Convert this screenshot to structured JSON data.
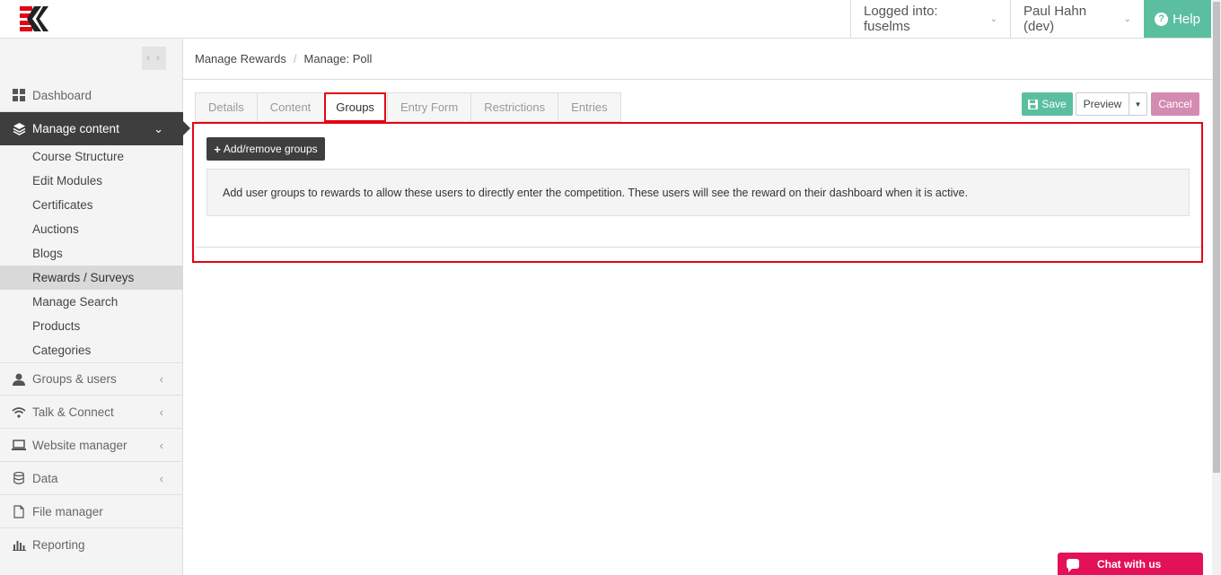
{
  "header": {
    "logged_into": "Logged into: fuselms",
    "user": "Paul Hahn (dev)",
    "help": "Help"
  },
  "sidebar": {
    "collapse_icon": "‹ ›",
    "items": [
      {
        "label": "Dashboard",
        "icon": "grid-icon"
      },
      {
        "label": "Manage content",
        "icon": "layers-icon",
        "active": true
      },
      {
        "label": "Groups & users",
        "icon": "user-icon"
      },
      {
        "label": "Talk & Connect",
        "icon": "wifi-icon"
      },
      {
        "label": "Website manager",
        "icon": "laptop-icon"
      },
      {
        "label": "Data",
        "icon": "database-icon"
      },
      {
        "label": "File manager",
        "icon": "file-icon"
      },
      {
        "label": "Reporting",
        "icon": "bar-chart-icon"
      }
    ],
    "subitems": [
      "Course Structure",
      "Edit Modules",
      "Certificates",
      "Auctions",
      "Blogs",
      "Rewards / Surveys",
      "Manage Search",
      "Products",
      "Categories"
    ]
  },
  "breadcrumb": {
    "items": [
      "Manage Rewards",
      "Manage: Poll"
    ],
    "separator": "/"
  },
  "tabs": [
    "Details",
    "Content",
    "Groups",
    "Entry Form",
    "Restrictions",
    "Entries"
  ],
  "toolbar": {
    "save": "Save",
    "preview": "Preview",
    "cancel": "Cancel"
  },
  "groups_panel": {
    "add_button": "Add/remove groups",
    "info_text": "Add user groups to rewards to allow these users to directly enter the competition. These users will see the reward on their dashboard when it is active."
  },
  "chat": {
    "label": "Chat with us"
  },
  "colors": {
    "accent_green": "#5bbf9f",
    "highlight_red": "#e30613",
    "cancel_pink": "#d48bb1",
    "chat_pink": "#e3105a",
    "sidebar_dark": "#3e3e3e"
  }
}
